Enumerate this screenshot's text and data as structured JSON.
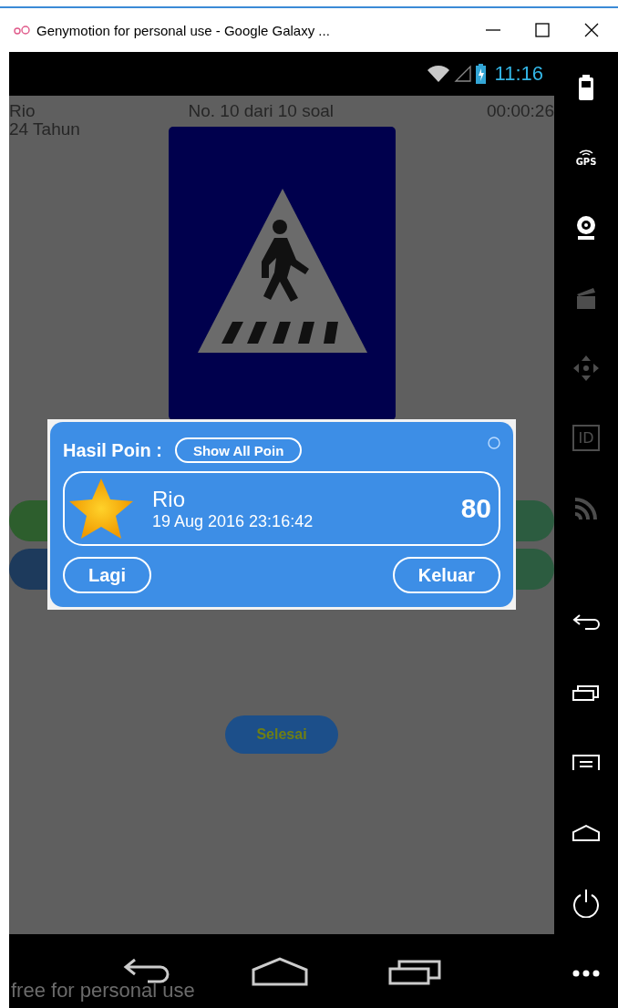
{
  "window": {
    "title": "Genymotion for personal use - Google Galaxy ..."
  },
  "status_bar": {
    "time": "11:16"
  },
  "quiz": {
    "name": "Rio",
    "progress": "No. 10 dari 10 soal",
    "timer": "00:00:26",
    "age": "24 Tahun",
    "finish_button": "Selesai"
  },
  "dialog": {
    "title": "Hasil Poin :",
    "show_all_button": "Show All Poin",
    "entry": {
      "name": "Rio",
      "date": "19 Aug 2016 23:16:42",
      "score": "80"
    },
    "buttons": [
      "Lagi",
      "Keluar"
    ]
  },
  "overlay_text": "free for personal use",
  "sidebar": [
    {
      "kind": "battery",
      "disabled": false
    },
    {
      "kind": "gps",
      "label": "GPS",
      "disabled": false
    },
    {
      "kind": "webcam",
      "disabled": false
    },
    {
      "kind": "clapper",
      "disabled": true
    },
    {
      "kind": "dpad",
      "disabled": true
    },
    {
      "kind": "id",
      "label": "ID",
      "disabled": true
    },
    {
      "kind": "rss",
      "disabled": true
    },
    {
      "kind": "back",
      "disabled": false
    },
    {
      "kind": "recent",
      "disabled": false
    },
    {
      "kind": "menu",
      "disabled": false
    },
    {
      "kind": "home",
      "disabled": false
    },
    {
      "kind": "power",
      "disabled": false
    },
    {
      "kind": "more",
      "disabled": false
    }
  ]
}
